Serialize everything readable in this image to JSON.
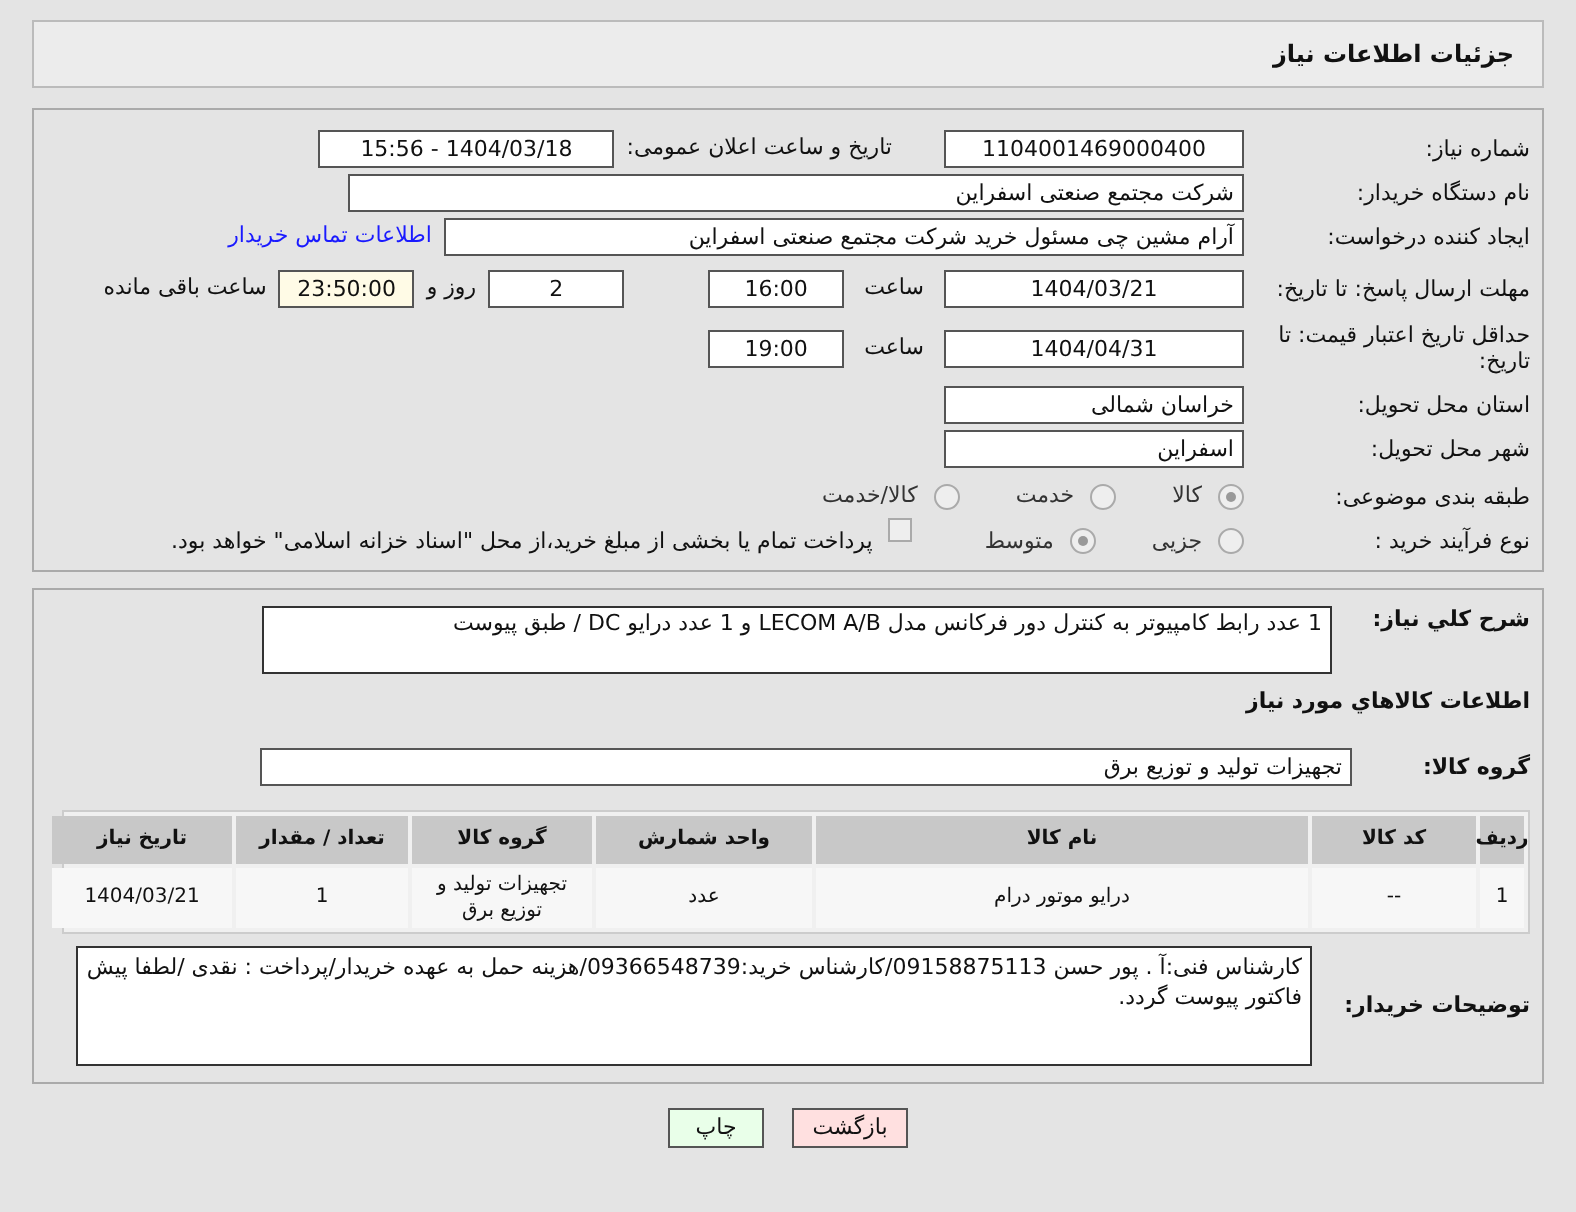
{
  "header": {
    "title": "جزئیات اطلاعات نیاز"
  },
  "fields": {
    "need_number": {
      "label": "شماره نیاز:",
      "value": "1104001469000400"
    },
    "announce": {
      "label": "تاریخ و ساعت اعلان عمومی:",
      "value": "1404/03/18 - 15:56"
    },
    "buyer": {
      "label": "نام دستگاه خریدار:",
      "value": "شرکت مجتمع صنعتی اسفراین"
    },
    "creator": {
      "label": "ایجاد کننده درخواست:",
      "value": "آرام مشین چی مسئول خرید شرکت مجتمع صنعتی اسفراین",
      "link": "اطلاعات تماس خریدار"
    },
    "deadline": {
      "label": "مهلت ارسال پاسخ: تا تاریخ:",
      "date": "1404/03/21",
      "time_label": "ساعت",
      "time": "16:00",
      "days": "2",
      "days_label": "روز و",
      "remaining": "23:50:00",
      "remaining_label": "ساعت باقی مانده"
    },
    "validity": {
      "label": "حداقل تاریخ اعتبار قیمت: تا تاریخ:",
      "date": "1404/04/31",
      "time_label": "ساعت",
      "time": "19:00"
    },
    "province": {
      "label": "استان محل تحویل:",
      "value": "خراسان شمالی"
    },
    "city": {
      "label": "شهر محل تحویل:",
      "value": "اسفراین"
    },
    "category": {
      "label": "طبقه بندی موضوعی:",
      "options": [
        {
          "label": "کالا",
          "selected": true
        },
        {
          "label": "خدمت",
          "selected": false
        },
        {
          "label": "کالا/خدمت",
          "selected": false
        }
      ]
    },
    "process": {
      "label": "نوع فرآیند خرید :",
      "options": [
        {
          "label": "جزیی",
          "selected": false
        },
        {
          "label": "متوسط",
          "selected": true
        }
      ],
      "treasury": {
        "label": "پرداخت تمام یا بخشی از مبلغ خرید،از محل \"اسناد خزانه اسلامی\" خواهد بود.",
        "checked": false
      }
    }
  },
  "description": {
    "label": "شرح کلي نياز:",
    "value": "1 عدد رابط کامپیوتر به کنترل دور فرکانس مدل LECOM A/B و 1 عدد درایو DC / طبق پیوست"
  },
  "goods_heading": "اطلاعات کالاهاي مورد نياز",
  "goods_group": {
    "label": "گروه کالا:",
    "value": "تجهیزات تولید و توزیع برق"
  },
  "table": {
    "columns": [
      "ردیف",
      "کد کالا",
      "نام کالا",
      "واحد شمارش",
      "گروه کالا",
      "تعداد / مقدار",
      "تاریخ نیاز"
    ],
    "rows": [
      [
        "1",
        "--",
        "درایو موتور درام",
        "عدد",
        "تجهیزات تولید و توزیع برق",
        "1",
        "1404/03/21"
      ]
    ]
  },
  "notes": {
    "label": "توضیحات خریدار:",
    "value": "کارشناس فنی:آ . پور حسن 09158875113/کارشناس خرید:09366548739/هزینه حمل به عهده خریدار/پرداخت : نقدی /لطفا پیش فاکتور پیوست گردد."
  },
  "buttons": [
    {
      "label": "بازگشت",
      "kind": "back"
    },
    {
      "label": "چاپ",
      "kind": "print"
    }
  ]
}
